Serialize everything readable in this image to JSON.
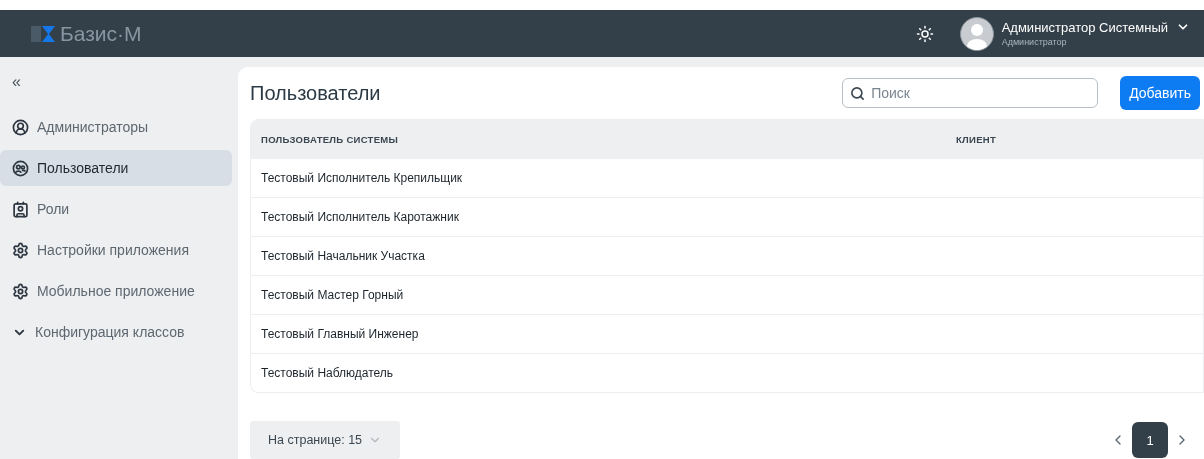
{
  "header": {
    "logo": "Базис·М",
    "user": {
      "name": "Администратор Системный",
      "role": "Администратор"
    }
  },
  "sidebar": {
    "collapse": "«",
    "items": [
      {
        "label": "Администраторы",
        "kind": "person",
        "selected": false
      },
      {
        "label": "Пользователи",
        "kind": "people",
        "selected": true
      },
      {
        "label": "Роли",
        "kind": "card",
        "selected": false
      },
      {
        "label": "Настройки приложения",
        "kind": "settings",
        "selected": false
      },
      {
        "label": "Мобильное приложение",
        "kind": "settings",
        "selected": false
      },
      {
        "label": "Конфигурация классов",
        "kind": "group",
        "selected": false
      }
    ]
  },
  "page": {
    "title": "Пользователи",
    "search": {
      "placeholder": "Поиск"
    },
    "add_button": "Добавить"
  },
  "table": {
    "columns": [
      "ПОЛЬЗОВАТЕЛЬ СИСТЕМЫ",
      "КЛИЕНТ"
    ],
    "rows": [
      [
        "Тестовый Исполнитель Крепильщик"
      ],
      [
        "Тестовый Исполнитель Каротажник"
      ],
      [
        "Тестовый Начальник Участка"
      ],
      [
        "Тестовый Мастер Горный"
      ],
      [
        "Тестовый Главный Инженер"
      ],
      [
        "Тестовый Наблюдатель"
      ]
    ]
  },
  "pagination": {
    "per_page_label": "На странице:",
    "per_page": "15",
    "pages": [
      {
        "label": "1",
        "selected": true
      }
    ]
  }
}
